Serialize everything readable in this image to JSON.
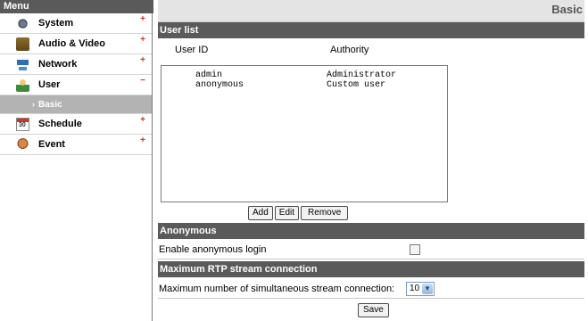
{
  "sidebar": {
    "header": "Menu",
    "items": [
      {
        "label": "System",
        "icon": "gear-icon",
        "sign": "+"
      },
      {
        "label": "Audio & Video",
        "icon": "camera-icon",
        "sign": "+"
      },
      {
        "label": "Network",
        "icon": "network-icon",
        "sign": "+"
      },
      {
        "label": "User",
        "icon": "user-icon",
        "sign": "−"
      },
      {
        "label": "Schedule",
        "icon": "calendar-icon",
        "sign": "+"
      },
      {
        "label": "Event",
        "icon": "event-icon",
        "sign": "+"
      }
    ],
    "submenu": {
      "label": "Basic",
      "arrow": "›"
    }
  },
  "page": {
    "title": "Basic"
  },
  "userlist": {
    "section": "User list",
    "col_userid": "User ID",
    "col_authority": "Authority",
    "rows": [
      {
        "user": "admin",
        "authority": "Administrator"
      },
      {
        "user": "anonymous",
        "authority": "Custom user"
      }
    ],
    "buttons": {
      "add": "Add",
      "edit": "Edit",
      "remove": "Remove"
    }
  },
  "anonymous": {
    "section": "Anonymous",
    "label": "Enable anonymous login",
    "checked": false
  },
  "rtp": {
    "section": "Maximum RTP stream connection",
    "label": "Maximum number of simultaneous stream connection:",
    "value": "10",
    "save": "Save"
  },
  "colors": {
    "header_bar": "#5a5a5a",
    "submenu_bg": "#b3b3b3",
    "sign": "#c0392b"
  }
}
